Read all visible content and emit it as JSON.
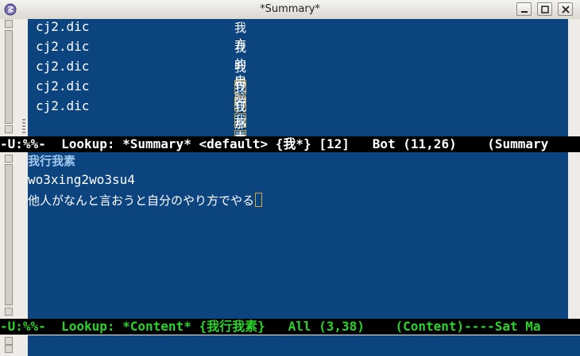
{
  "window": {
    "title": "*Summary*"
  },
  "summary": {
    "rows": [
      {
        "dict": "cj2.dic",
        "word": "我方"
      },
      {
        "dict": "cj2.dic",
        "word": "我的电脑"
      },
      {
        "dict": "cj2.dic",
        "word": "我行"
      },
      {
        "dict": "cj2.dic",
        "word": "我行我素"
      },
      {
        "dict": "cj2.dic",
        "word": "我那口子"
      }
    ]
  },
  "modeline_summary": "-U:%%-  Lookup: *Summary* <default> {我*} [12]   Bot (11,26)    (Summary",
  "content": {
    "heading": "我行我素",
    "pinyin": "wo3xing2wo3su4",
    "definition": "他人がなんと言おうと自分のやり方でやる"
  },
  "modeline_content": "-U:%%-  Lookup: *Content* {我行我素}   All (3,38)    (Content)----Sat Ma",
  "colors": {
    "background": "#0c4480",
    "modeline_bg": "#000000",
    "content_modeline_fg": "#29d229",
    "cursor": "#d4a640"
  }
}
